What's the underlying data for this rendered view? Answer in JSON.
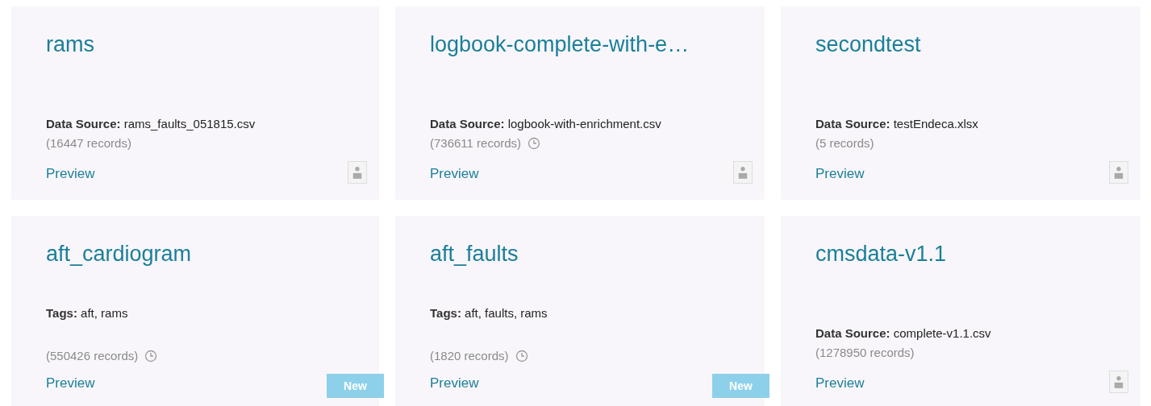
{
  "cards": [
    {
      "title": "rams",
      "kind": "source",
      "label": "Data Source:",
      "value": "rams_faults_051815.csv",
      "records": "(16447 records)",
      "history": false,
      "new": false,
      "link": "Preview"
    },
    {
      "title": "logbook-complete-with-e…",
      "kind": "source",
      "label": "Data Source:",
      "value": "logbook-with-enrichment.csv",
      "records": "(736611 records)",
      "history": true,
      "new": false,
      "link": "Preview"
    },
    {
      "title": "secondtest",
      "kind": "source",
      "label": "Data Source:",
      "value": "testEndeca.xlsx",
      "records": "(5 records)",
      "history": false,
      "new": false,
      "link": "Preview"
    },
    {
      "title": "aft_cardiogram",
      "kind": "tags",
      "label": "Tags:",
      "value": "aft, rams",
      "records": "(550426 records)",
      "history": true,
      "new": true,
      "badge": "New",
      "link": "Preview"
    },
    {
      "title": "aft_faults",
      "kind": "tags",
      "label": "Tags:",
      "value": "aft, faults, rams",
      "records": "(1820 records)",
      "history": true,
      "new": true,
      "badge": "New",
      "link": "Preview"
    },
    {
      "title": "cmsdata-v1.1",
      "kind": "source",
      "label": "Data Source:",
      "value": "complete-v1.1.csv",
      "records": "(1278950 records)",
      "history": false,
      "new": false,
      "link": "Preview"
    }
  ]
}
